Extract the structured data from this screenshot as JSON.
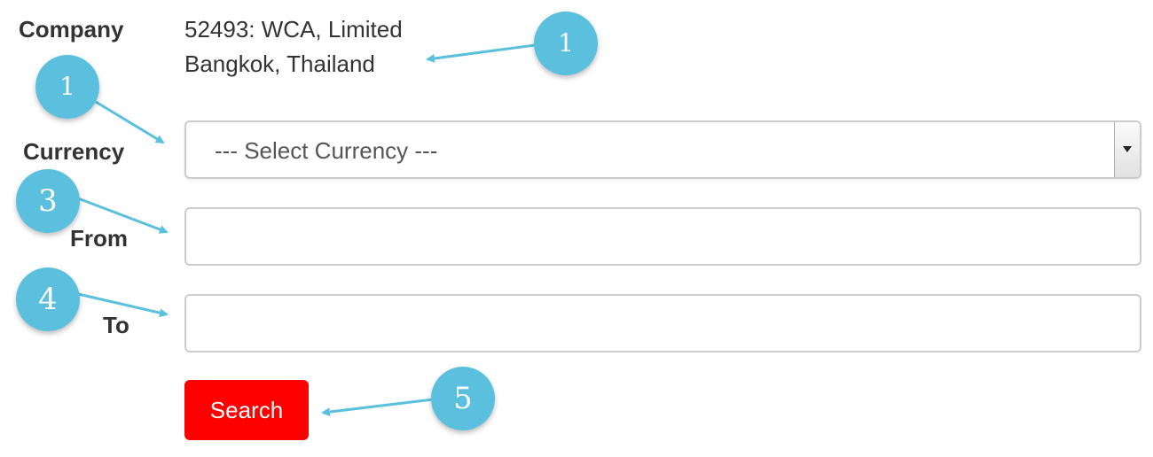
{
  "form": {
    "company_label": "Company",
    "company_line1": "52493: WCA, Limited",
    "company_line2": "Bangkok, Thailand",
    "currency_label": "Currency",
    "currency_select": {
      "selected": "--- Select Currency ---"
    },
    "from_label": "From",
    "from_value": "",
    "to_label": "To",
    "to_value": "",
    "search_label": "Search"
  },
  "annotations": {
    "badges": [
      "1",
      "1",
      "3",
      "4",
      "5"
    ],
    "badge_color": "#5bc0de",
    "arrow_color": "#5bc0de"
  },
  "colors": {
    "search_button": "#ff0000",
    "text": "#333333"
  }
}
